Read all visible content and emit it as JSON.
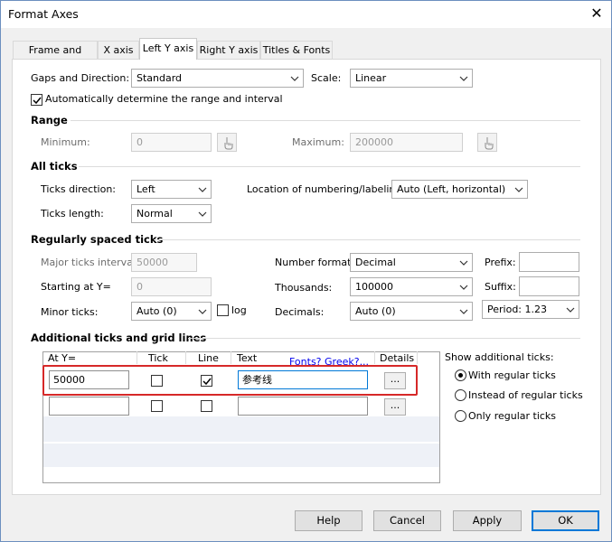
{
  "window": {
    "title": "Format Axes",
    "close_glyph": "✕"
  },
  "tabs": [
    {
      "label": "Frame and Origin"
    },
    {
      "label": "X axis"
    },
    {
      "label": "Left Y axis"
    },
    {
      "label": "Right Y axis"
    },
    {
      "label": "Titles & Fonts"
    }
  ],
  "gaps": {
    "label": "Gaps and Direction:",
    "value": "Standard"
  },
  "scale": {
    "label": "Scale:",
    "value": "Linear"
  },
  "auto_range": {
    "label": "Automatically determine the range and interval",
    "checked": true
  },
  "range": {
    "heading": "Range",
    "minimum_label": "Minimum:",
    "minimum_value": "0",
    "maximum_label": "Maximum:",
    "maximum_value": "200000"
  },
  "all_ticks": {
    "heading": "All ticks",
    "direction_label": "Ticks direction:",
    "direction_value": "Left",
    "length_label": "Ticks length:",
    "length_value": "Normal",
    "location_label": "Location of numbering/labeling:",
    "location_value": "Auto (Left, horizontal)"
  },
  "regular": {
    "heading": "Regularly spaced ticks",
    "major_label": "Major ticks interval:",
    "major_value": "50000",
    "starting_label": "Starting at Y=",
    "starting_value": "0",
    "minor_label": "Minor ticks:",
    "minor_value": "Auto (0)",
    "log_label": "log",
    "number_format_label": "Number format:",
    "number_format_value": "Decimal",
    "thousands_label": "Thousands:",
    "thousands_value": "100000",
    "decimals_label": "Decimals:",
    "decimals_value": "Auto (0)",
    "prefix_label": "Prefix:",
    "prefix_value": "",
    "suffix_label": "Suffix:",
    "suffix_value": "",
    "period_value": "Period: 1.23"
  },
  "additional": {
    "heading": "Additional ticks and grid lines",
    "columns": [
      "At Y=",
      "Tick",
      "Line",
      "Text",
      "Details"
    ],
    "fonts_link": "Fonts? Greek?...",
    "rows": [
      {
        "at_y": "50000",
        "tick": false,
        "line": true,
        "text": "参考线",
        "details": "..."
      },
      {
        "at_y": "",
        "tick": false,
        "line": false,
        "text": "",
        "details": "..."
      }
    ],
    "show_label": "Show additional ticks:",
    "options": [
      {
        "label": "With regular ticks",
        "selected": true
      },
      {
        "label": "Instead of regular ticks",
        "selected": false
      },
      {
        "label": "Only regular ticks",
        "selected": false
      }
    ]
  },
  "buttons": {
    "help": "Help",
    "cancel": "Cancel",
    "apply": "Apply",
    "ok": "OK"
  }
}
